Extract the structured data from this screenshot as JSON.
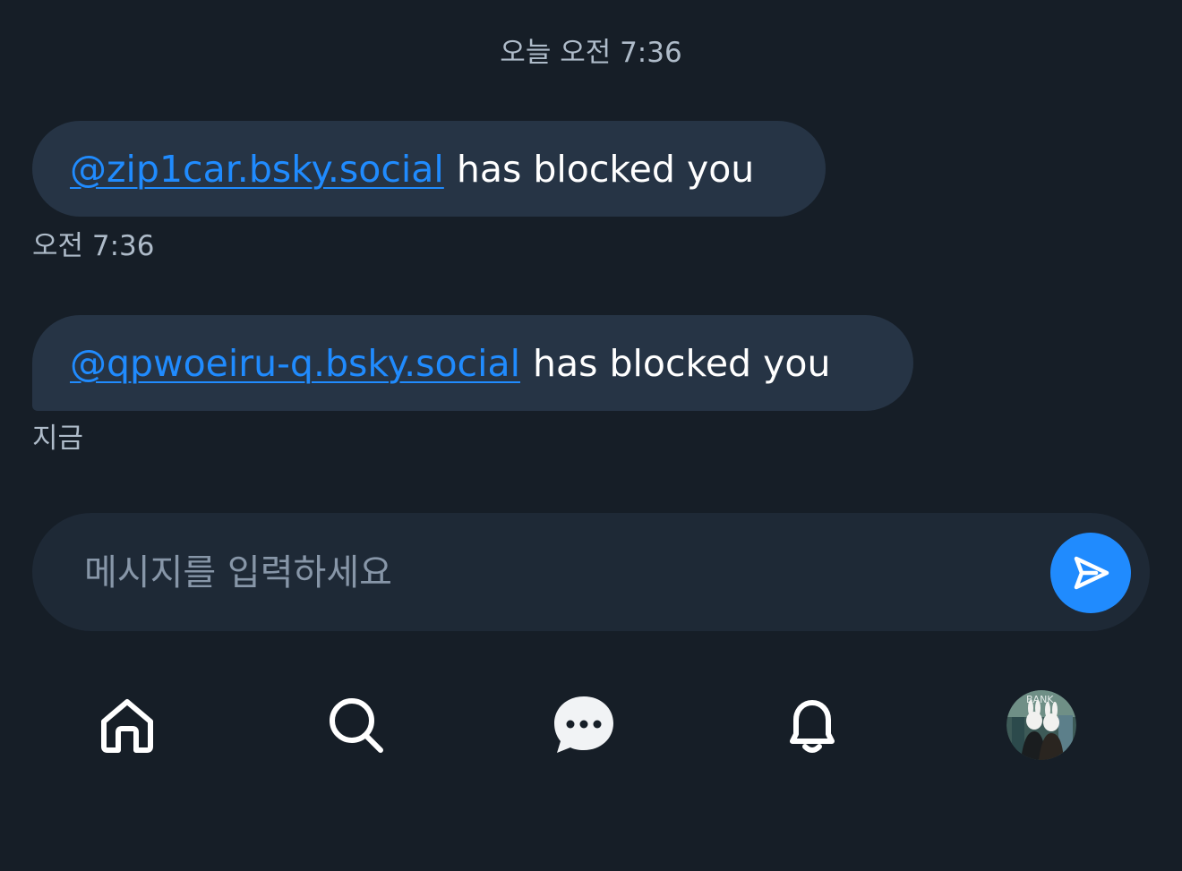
{
  "chat": {
    "date_divider": "오늘 오전 7:36",
    "messages": [
      {
        "handle": "@zip1car.bsky.social",
        "text": "has blocked you",
        "time": "오전 7:36"
      },
      {
        "handle": "@qpwoeiru-q.bsky.social",
        "text": "has blocked you",
        "time": "지금"
      }
    ]
  },
  "composer": {
    "placeholder": "메시지를 입력하세요",
    "value": "",
    "send_icon": "send-icon"
  },
  "nav": {
    "items": [
      {
        "name": "home",
        "icon": "home-icon"
      },
      {
        "name": "search",
        "icon": "search-icon"
      },
      {
        "name": "messages",
        "icon": "chat-bubble-icon"
      },
      {
        "name": "notifications",
        "icon": "bell-icon"
      },
      {
        "name": "profile",
        "icon": "avatar"
      }
    ]
  },
  "avatar_text": "BANK",
  "colors": {
    "background": "#161e27",
    "bubble": "#263445",
    "composer": "#1e2936",
    "accent": "#208bfe",
    "muted_text": "#aebbc9",
    "text": "#ffffff"
  }
}
